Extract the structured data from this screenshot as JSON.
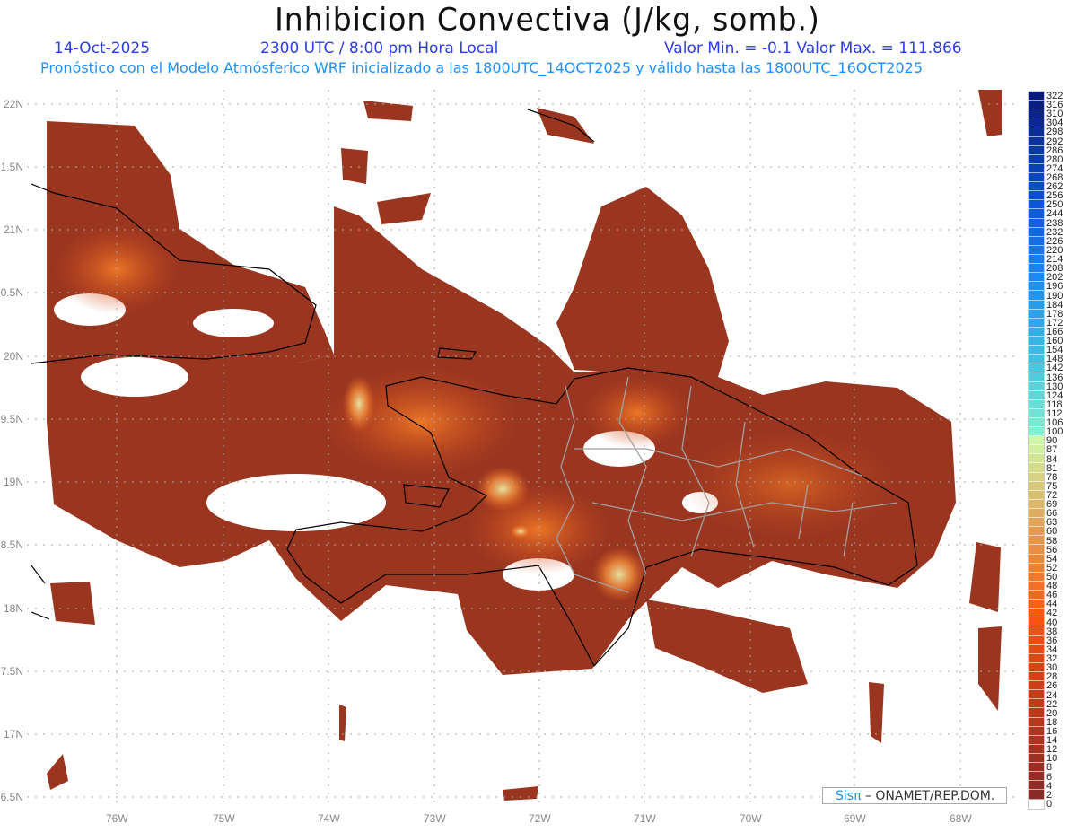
{
  "header": {
    "title": "Inhibicion Convectiva (J/kg, somb.)",
    "date": "14-Oct-2025",
    "time": "2300 UTC / 8:00 pm Hora Local",
    "minmax": "Valor Min. = -0.1  Valor Max. = 111.866",
    "model_info": "Pronóstico con el Modelo Atmósferico WRF inicializado a las 1800UTC_14OCT2025 y válido hasta las  1800UTC_16OCT2025"
  },
  "axes": {
    "lat_labels": [
      "22N",
      "1.5N",
      "21N",
      "0.5N",
      "20N",
      "9.5N",
      "19N",
      "8.5N",
      "18N",
      "7.5N",
      "17N",
      "6.5N"
    ],
    "lon_labels": [
      "76W",
      "75W",
      "74W",
      "73W",
      "72W",
      "71W",
      "70W",
      "69W",
      "68W"
    ]
  },
  "legend": {
    "labels": [
      "322",
      "316",
      "310",
      "304",
      "298",
      "292",
      "286",
      "280",
      "274",
      "268",
      "262",
      "256",
      "250",
      "244",
      "238",
      "232",
      "226",
      "220",
      "214",
      "208",
      "202",
      "196",
      "190",
      "184",
      "178",
      "172",
      "166",
      "160",
      "154",
      "148",
      "142",
      "136",
      "130",
      "124",
      "118",
      "112",
      "106",
      "100",
      "90",
      "87",
      "84",
      "81",
      "78",
      "75",
      "72",
      "69",
      "66",
      "63",
      "60",
      "58",
      "56",
      "54",
      "52",
      "50",
      "48",
      "46",
      "44",
      "42",
      "40",
      "38",
      "36",
      "34",
      "32",
      "30",
      "28",
      "26",
      "24",
      "22",
      "20",
      "18",
      "16",
      "14",
      "12",
      "10",
      "8",
      "6",
      "4",
      "2",
      "0"
    ],
    "color_stops": [
      {
        "value": 322,
        "color": "#0a1a7a"
      },
      {
        "value": 250,
        "color": "#0a55d8"
      },
      {
        "value": 200,
        "color": "#1a8cf5"
      },
      {
        "value": 150,
        "color": "#3cc0e0"
      },
      {
        "value": 100,
        "color": "#80f0d0"
      },
      {
        "value": 90,
        "color": "#d0f8a8"
      },
      {
        "value": 72,
        "color": "#d8c070"
      },
      {
        "value": 56,
        "color": "#e89040"
      },
      {
        "value": 42,
        "color": "#f85a08"
      },
      {
        "value": 24,
        "color": "#c83a18"
      },
      {
        "value": 2,
        "color": "#8a2a28"
      },
      {
        "value": 0,
        "color": "#ffffff"
      }
    ]
  },
  "colors": {
    "field_base": "#99361f",
    "field_mid": "#c04418",
    "field_hot": "#f07020",
    "field_peak": "#d8e090",
    "coast": "#000000",
    "provinces": "#a0a0a0"
  },
  "credit": {
    "brand": "Sisπ",
    "text": " –  ONAMET/REP.DOM."
  }
}
